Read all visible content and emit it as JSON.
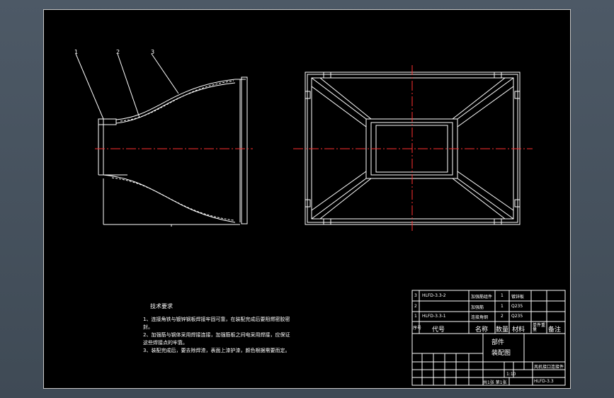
{
  "callouts": [
    "1",
    "2",
    "3"
  ],
  "notes": {
    "title": "技术要求",
    "items": [
      "1、连接角铁与镀锌钢板焊接牢固可靠，在装配完成后要阻燃密胶密封。",
      "2、加强筋与钢体采用焊接连接，加强筋板之间电采用焊接，应保证这些焊接点的牢靠。",
      "3、装配完成后，要去除焊渣，表面上漆护漆，颜色根据需要而定。"
    ]
  },
  "parts": [
    {
      "no": "3",
      "code": "HLFD-3.3-2",
      "name": "加强筋组件",
      "qty": "1",
      "material": "镀锌板"
    },
    {
      "no": "2",
      "code": "",
      "name": "加强筋",
      "qty": "1",
      "material": "Q235"
    },
    {
      "no": "1",
      "code": "HLFD-3.3-1",
      "name": "连接角钢",
      "qty": "2",
      "material": "Q235"
    }
  ],
  "header": {
    "no": "序号",
    "code": "代号",
    "name": "名称",
    "qty": "数量",
    "material": "材料",
    "weight": "单件重量",
    "remark": "备注"
  },
  "title_block": {
    "line1": "部件",
    "line2": "装配图",
    "drawing_name": "风机接口连接件",
    "scale": "1:10",
    "sheets": "共1张 第1张",
    "drawing_no": "HLFD-3.3"
  },
  "colors": {
    "sheet": "#000000",
    "line": "#ffffff",
    "center": "#ff3030",
    "desktop": "#47525e"
  }
}
